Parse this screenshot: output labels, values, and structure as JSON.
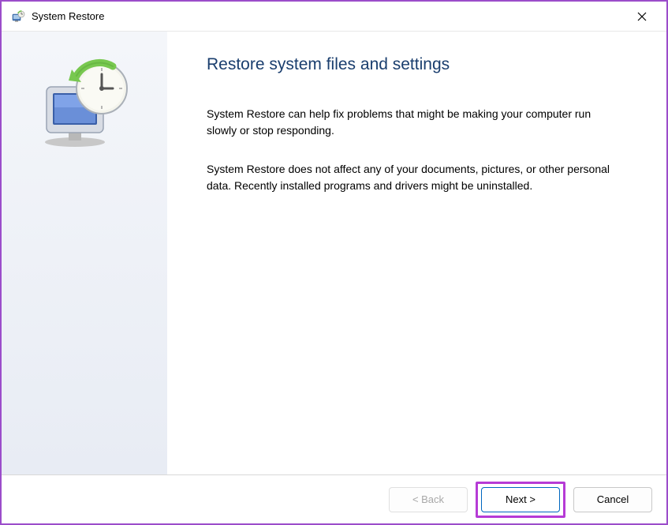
{
  "titlebar": {
    "title": "System Restore"
  },
  "main": {
    "heading": "Restore system files and settings",
    "paragraph1": "System Restore can help fix problems that might be making your computer run slowly or stop responding.",
    "paragraph2": "System Restore does not affect any of your documents, pictures, or other personal data. Recently installed programs and drivers might be uninstalled."
  },
  "footer": {
    "back_label": "< Back",
    "next_label": "Next >",
    "cancel_label": "Cancel"
  }
}
